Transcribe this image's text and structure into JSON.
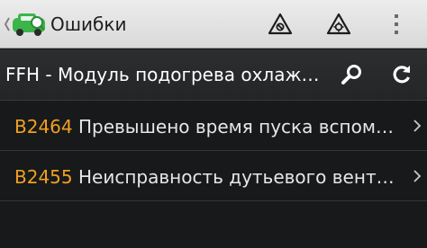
{
  "app": {
    "title": "Ошибки",
    "icons": {
      "back": "chevron-left-icon",
      "logo": "car-diagnostic-logo",
      "action1": "warning-triangle-icon",
      "action2": "warning-triangle-gear-icon",
      "menu": "overflow-menu-icon"
    }
  },
  "module": {
    "title": "FFH - Модуль подогрева охлаждающей жидкости",
    "icons": {
      "search": "search-icon",
      "refresh": "refresh-icon"
    }
  },
  "errors": [
    {
      "code": "B2464",
      "description": "Превышено время пуска вспомогательного отопителя"
    },
    {
      "code": "B2455",
      "description": "Неисправность дутьевого вентилятора"
    }
  ],
  "colors": {
    "code": "#f0a020",
    "logo_green": "#3bb54a",
    "action_bar": "#e3e3e3",
    "background": "#17191b"
  }
}
